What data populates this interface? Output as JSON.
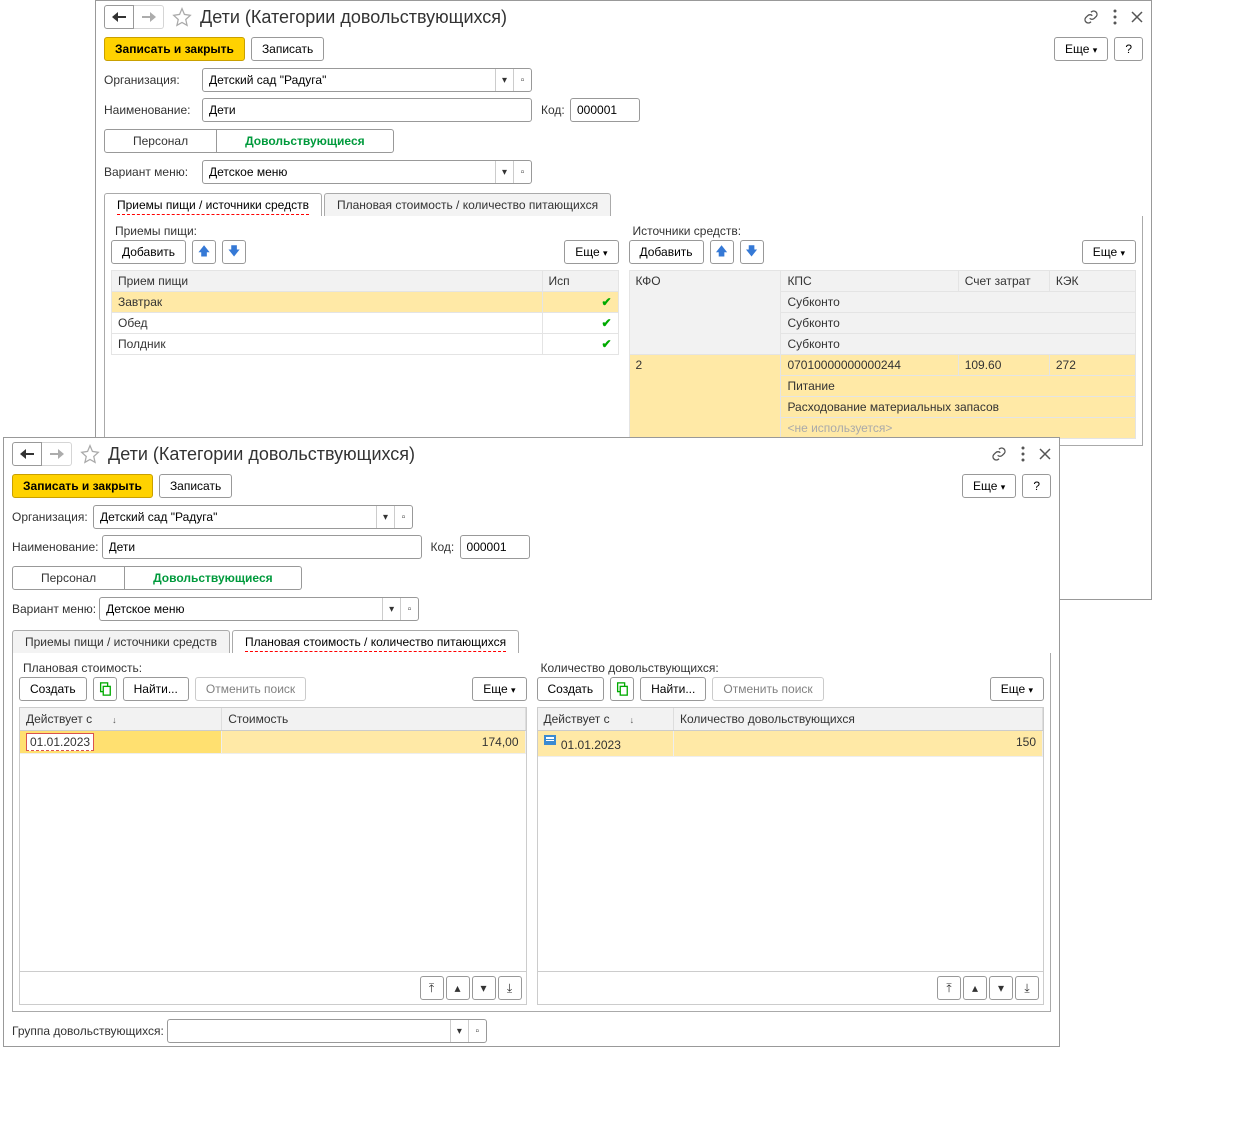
{
  "win1": {
    "title": "Дети (Категории довольствующихся)",
    "save_close": "Записать и закрыть",
    "save": "Записать",
    "more": "Еще",
    "help": "?",
    "org_label": "Организация:",
    "org_value": "Детский сад \"Радуга\"",
    "name_label": "Наименование:",
    "name_value": "Дети",
    "code_label": "Код:",
    "code_value": "000001",
    "seg_personnel": "Персонал",
    "seg_consumers": "Довольствующиеся",
    "menu_label": "Вариант меню:",
    "menu_value": "Детское меню",
    "tab1": "Приемы пищи / источники средств",
    "tab2": "Плановая стоимость / количество питающихся",
    "meals_title": "Приемы пищи:",
    "funds_title": "Источники средств:",
    "add": "Добавить",
    "col_meal": "Прием пищи",
    "col_used": "Исп",
    "meals": [
      {
        "name": "Завтрак",
        "used": true
      },
      {
        "name": "Обед",
        "used": true
      },
      {
        "name": "Полдник",
        "used": true
      }
    ],
    "fcol_kfo": "КФО",
    "fcol_kps": "КПС",
    "fcol_acc": "Счет затрат",
    "fcol_kek": "КЭК",
    "fsub": "Субконто",
    "frow": {
      "kfo": "2",
      "kps": "07010000000000244",
      "acc": "109.60",
      "kek": "272",
      "sub1": "Питание",
      "sub2": "Расходование материальных запасов",
      "sub3": "<не используется>"
    }
  },
  "win2": {
    "title": "Дети (Категории довольствующихся)",
    "save_close": "Записать и закрыть",
    "save": "Записать",
    "more": "Еще",
    "help": "?",
    "org_label": "Организация:",
    "org_value": "Детский сад \"Радуга\"",
    "name_label": "Наименование:",
    "name_value": "Дети",
    "code_label": "Код:",
    "code_value": "000001",
    "seg_personnel": "Персонал",
    "seg_consumers": "Довольствующиеся",
    "menu_label": "Вариант меню:",
    "menu_value": "Детское меню",
    "tab1": "Приемы пищи / источники средств",
    "tab2": "Плановая стоимость / количество питающихся",
    "plan_title": "Плановая стоимость:",
    "qty_title": "Количество довольствующихся:",
    "create": "Создать",
    "find": "Найти...",
    "cancel_find": "Отменить поиск",
    "col_date": "Действует с",
    "col_cost": "Стоимость",
    "col_qty": "Количество довольствующихся",
    "plan_row": {
      "date": "01.01.2023",
      "cost": "174,00"
    },
    "qty_row": {
      "date": "01.01.2023",
      "qty": "150"
    },
    "group_label": "Группа довольствующихся:"
  }
}
